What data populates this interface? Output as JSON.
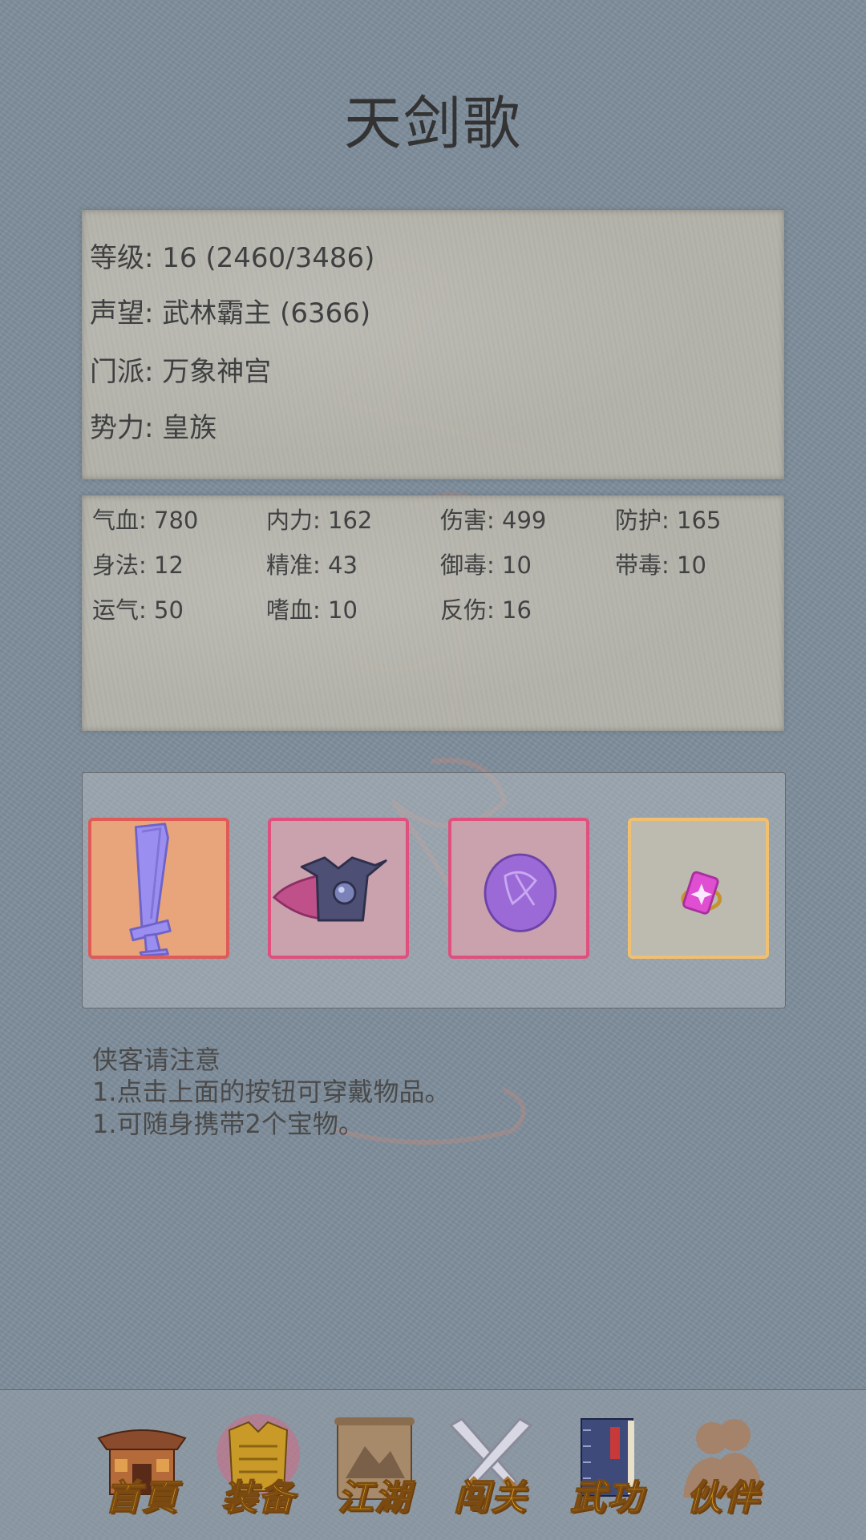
{
  "title": "天剑歌",
  "info": {
    "level": {
      "label": "等级",
      "value": "16 (2460/3486)"
    },
    "fame": {
      "label": "声望",
      "value": "武林霸主 (6366)"
    },
    "sect": {
      "label": "门派",
      "value": "万象神宫"
    },
    "faction": {
      "label": "势力",
      "value": "皇族"
    }
  },
  "stats": [
    {
      "label": "气血",
      "value": "780"
    },
    {
      "label": "内力",
      "value": "162"
    },
    {
      "label": "伤害",
      "value": "499"
    },
    {
      "label": "防护",
      "value": "165"
    },
    {
      "label": "身法",
      "value": "12"
    },
    {
      "label": "精准",
      "value": "43"
    },
    {
      "label": "御毒",
      "value": "10"
    },
    {
      "label": "带毒",
      "value": "10"
    },
    {
      "label": "运气",
      "value": "50"
    },
    {
      "label": "嗜血",
      "value": "10"
    },
    {
      "label": "反伤",
      "value": "16"
    }
  ],
  "equipment": [
    {
      "icon": "sword-icon",
      "border": "#e05a58",
      "bg": "#e8a57c"
    },
    {
      "icon": "armor-icon",
      "border": "#e0507e",
      "bg": "#c9a2ae"
    },
    {
      "icon": "orb-icon",
      "border": "#e0507e",
      "bg": "#c9a2ae"
    },
    {
      "icon": "ring-icon",
      "border": "#f0c070",
      "bg": "#bdbab0"
    }
  ],
  "notes": {
    "heading": "侠客请注意",
    "line1": "1.点击上面的按钮可穿戴物品。",
    "line2": "1.可随身携带2个宝物。"
  },
  "nav": [
    {
      "label": "首頁",
      "icon": "house-icon"
    },
    {
      "label": "装备",
      "icon": "armor-icon"
    },
    {
      "label": "江湖",
      "icon": "scroll-icon"
    },
    {
      "label": "闯关",
      "icon": "crossed-swords-icon"
    },
    {
      "label": "武功",
      "icon": "book-icon"
    },
    {
      "label": "伙伴",
      "icon": "companions-icon"
    }
  ],
  "colors": {
    "label_gold": "#f2b822",
    "background": "#7f8e9c"
  }
}
